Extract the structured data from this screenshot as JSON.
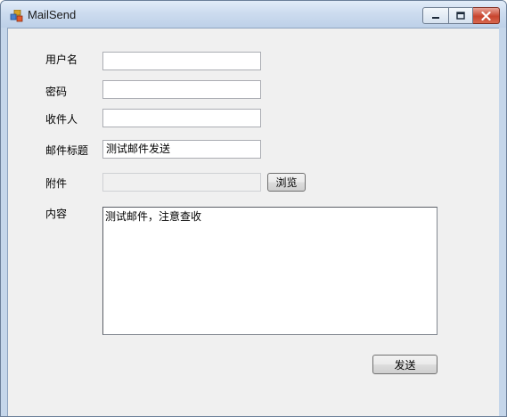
{
  "window": {
    "title": "MailSend"
  },
  "form": {
    "username_label": "用户名",
    "username_value": "",
    "password_label": "密码",
    "password_value": "",
    "recipient_label": "收件人",
    "recipient_value": "",
    "subject_label": "邮件标题",
    "subject_value": "测试邮件发送",
    "attachment_label": "附件",
    "attachment_value": "",
    "browse_label": "浏览",
    "content_label": "内容",
    "content_value": "测试邮件，注意查收",
    "send_label": "发送"
  },
  "colors": {
    "titlebar": "#cddcef",
    "client": "#f0f0f0",
    "close_button": "#c8442e"
  }
}
